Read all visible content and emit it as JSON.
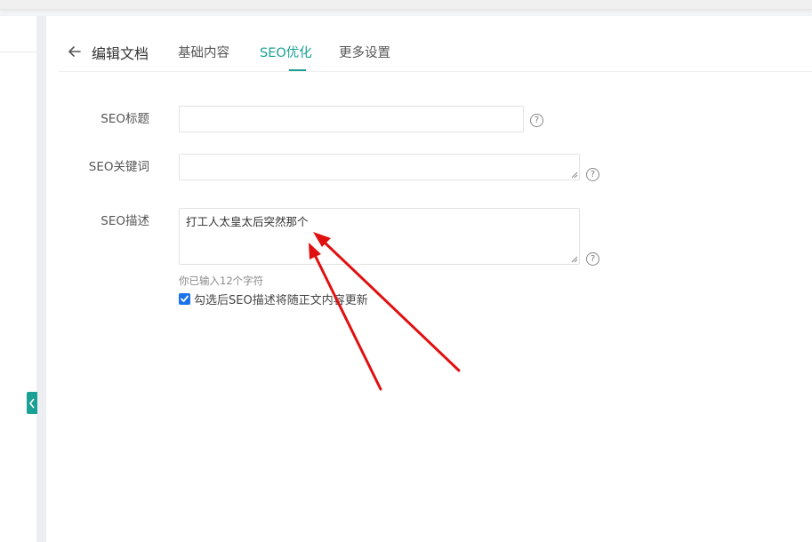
{
  "header": {
    "title": "编辑文档",
    "tabs": [
      {
        "label": "基础内容",
        "active": false
      },
      {
        "label": "SEO优化",
        "active": true
      },
      {
        "label": "更多设置",
        "active": false
      }
    ]
  },
  "form": {
    "seo_title": {
      "label": "SEO标题",
      "value": "",
      "help": "?"
    },
    "seo_keywords": {
      "label": "SEO关键词",
      "value": "",
      "help": "?"
    },
    "seo_description": {
      "label": "SEO描述",
      "value": "打工人太皇太后突然那个",
      "help": "?"
    },
    "char_count_text": "你已输入12个字符",
    "sync_checkbox": {
      "label": "勾选后SEO描述将随正文内容更新",
      "checked": true
    }
  },
  "colors": {
    "accent": "#1aa094",
    "checkbox": "#1a73e8",
    "annotation_arrow": "#e01010"
  },
  "icons": {
    "back": "arrow-left-icon",
    "collapse": "chevron-left-icon",
    "help": "question-circle-icon",
    "check": "check-icon"
  }
}
